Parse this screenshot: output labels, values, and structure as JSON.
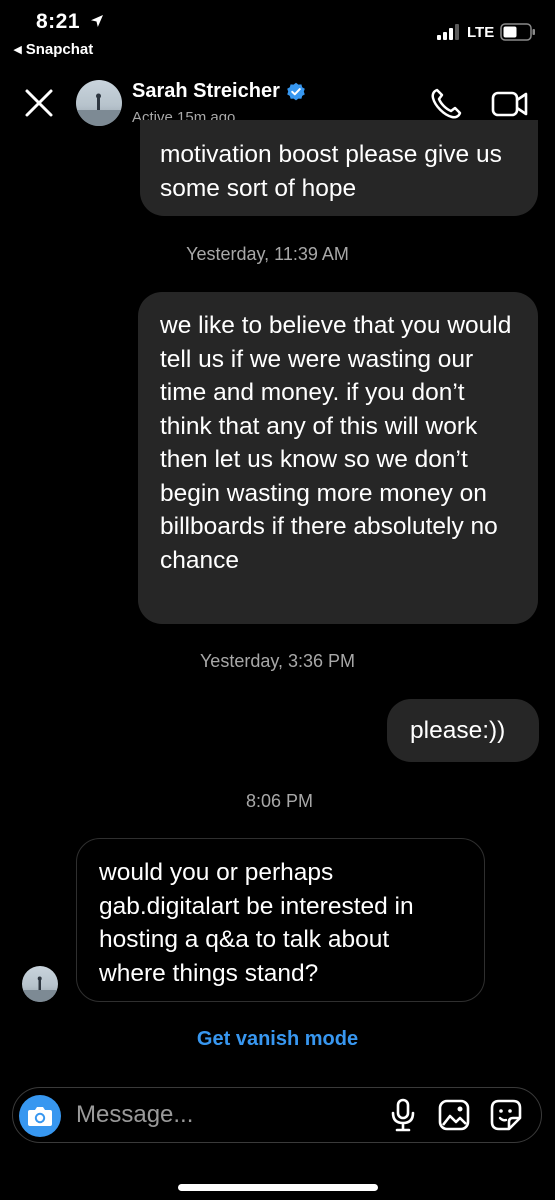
{
  "status_bar": {
    "time": "8:21",
    "back_app": "◂ Snapchat",
    "network": "LTE",
    "icons": [
      "location-arrow-icon",
      "signal-icon",
      "battery-icon"
    ]
  },
  "header": {
    "contact_name": "Sarah Streicher",
    "status": "Active 15m ago",
    "icons": [
      "close-icon",
      "verified-badge-icon",
      "phone-icon",
      "video-camera-icon"
    ]
  },
  "messages": [
    {
      "sender": "me",
      "text": "motivation boost please give us some sort of hope"
    },
    {
      "type": "timestamp",
      "text": "Yesterday, 11:39 AM"
    },
    {
      "sender": "me",
      "text": "we like to believe that you would tell us if we were wasting our time and money. if you don’t think that any of this will work then let us know so we don’t begin wasting more money on billboards if there absolutely no chance"
    },
    {
      "type": "timestamp",
      "text": "Yesterday, 3:36 PM"
    },
    {
      "sender": "me",
      "text": "please:))"
    },
    {
      "type": "timestamp",
      "text": "8:06 PM"
    },
    {
      "sender": "them",
      "text": "would you or perhaps gab.digitalart be interested in hosting a q&a to talk about where things stand?"
    }
  ],
  "vanish_mode": "Get vanish mode",
  "composer": {
    "placeholder": "Message...",
    "icons": [
      "camera-icon",
      "microphone-icon",
      "gallery-icon",
      "sticker-icon"
    ]
  },
  "colors": {
    "background": "#000000",
    "bubble": "#262626",
    "accent": "#3797f0",
    "secondary_text": "#a8a8a8"
  }
}
